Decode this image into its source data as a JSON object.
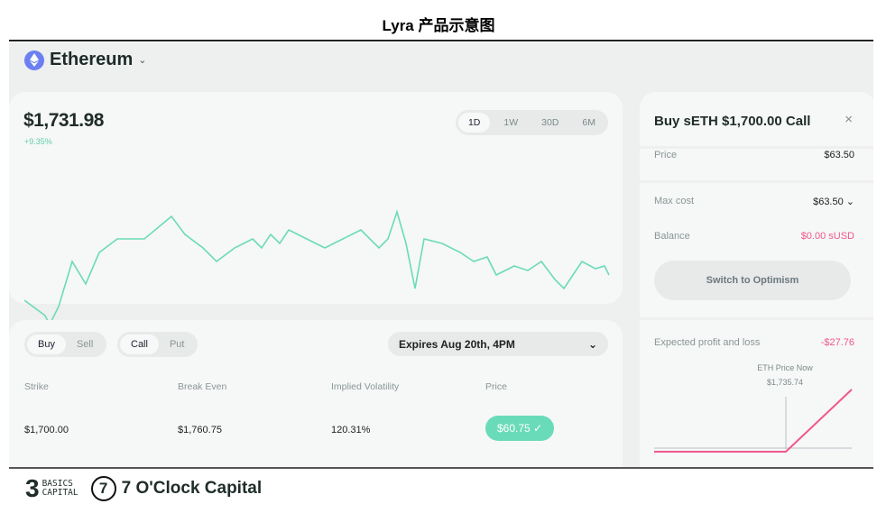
{
  "page_title": "Lyra 产品示意图",
  "asset": {
    "name": "Ethereum",
    "icon": "ethereum-icon"
  },
  "chart": {
    "price": "$1,731.98",
    "change": "+9.35%",
    "ranges": [
      "1D",
      "1W",
      "30D",
      "6M"
    ],
    "selected_range": "1D"
  },
  "chart_data": {
    "type": "line",
    "color": "#6adbb8",
    "x": [
      0,
      23,
      28,
      38,
      53,
      68,
      83,
      103,
      133,
      163,
      178,
      198,
      213,
      233,
      253,
      263,
      273,
      283,
      293,
      313,
      333,
      353,
      373,
      393,
      403,
      413,
      423,
      433,
      443,
      463,
      483,
      498,
      513,
      523,
      543,
      558,
      573,
      588,
      598,
      608,
      618,
      633,
      643,
      648
    ],
    "values": [
      37,
      20,
      10,
      30,
      80,
      55,
      90,
      105,
      105,
      130,
      110,
      95,
      80,
      95,
      105,
      95,
      110,
      100,
      115,
      105,
      95,
      105,
      115,
      95,
      105,
      135,
      100,
      50,
      105,
      100,
      90,
      80,
      85,
      65,
      75,
      70,
      80,
      60,
      50,
      65,
      80,
      72,
      75,
      65
    ],
    "ylim": [
      0,
      150
    ]
  },
  "trade": {
    "side_options": [
      "Buy",
      "Sell"
    ],
    "side": "Buy",
    "type_options": [
      "Call",
      "Put"
    ],
    "type": "Call",
    "expiry": "Expires Aug 20th, 4PM",
    "headers": [
      "Strike",
      "Break Even",
      "Implied Volatility",
      "Price"
    ],
    "row": {
      "strike": "$1,700.00",
      "break_even": "$1,760.75",
      "iv": "120.31%",
      "price": "$60.75 ✓"
    }
  },
  "order": {
    "title": "Buy sETH $1,700.00 Call",
    "close": "×",
    "price_label": "Price",
    "price": "$63.50",
    "max_cost_label": "Max cost",
    "max_cost": "$63.50 ⌄",
    "balance_label": "Balance",
    "balance": "$0.00 sUSD",
    "switch": "Switch to Optimism",
    "pnl_label": "Expected profit and loss",
    "pnl": "-$27.76",
    "now_label": "ETH Price Now",
    "now_price": "$1,735.74",
    "accent": "#f0578b"
  },
  "footer": {
    "logo1_top": "BASICS",
    "logo1_bottom": "CAPITAL",
    "logo2": "7 O'Clock Capital"
  }
}
